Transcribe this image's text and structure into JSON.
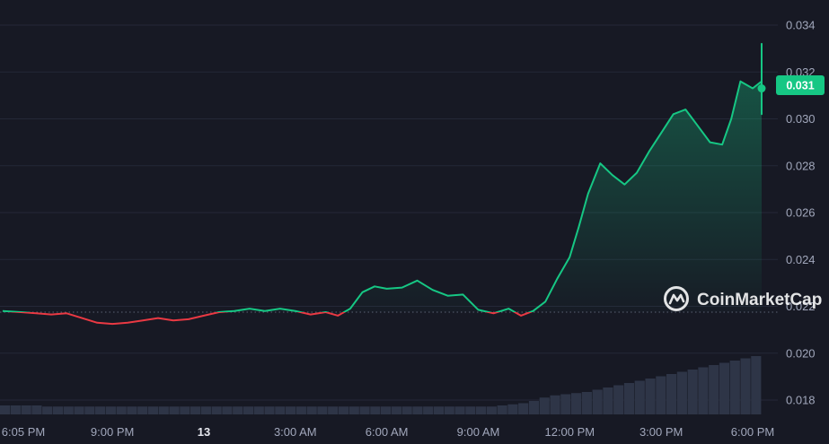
{
  "chart_data": {
    "type": "line",
    "reference_value": 0.02175,
    "current_price": 0.031,
    "current_price_label": "0.031",
    "ylim": [
      0.0175,
      0.0345
    ],
    "y_ticks": [
      {
        "value": 0.018,
        "label": "0.018"
      },
      {
        "value": 0.02,
        "label": "0.020"
      },
      {
        "value": 0.022,
        "label": "0.022"
      },
      {
        "value": 0.024,
        "label": "0.024"
      },
      {
        "value": 0.026,
        "label": "0.026"
      },
      {
        "value": 0.028,
        "label": "0.028"
      },
      {
        "value": 0.03,
        "label": "0.030"
      },
      {
        "value": 0.032,
        "label": "0.032"
      },
      {
        "value": 0.034,
        "label": "0.034"
      }
    ],
    "x_range": [
      -0.6,
      24.1
    ],
    "x_ticks": [
      {
        "value": 0.08,
        "label": "6:05 PM",
        "bold": false
      },
      {
        "value": 3,
        "label": "9:00 PM",
        "bold": false
      },
      {
        "value": 6,
        "label": "13",
        "bold": true
      },
      {
        "value": 9,
        "label": "3:00 AM",
        "bold": false
      },
      {
        "value": 12,
        "label": "6:00 AM",
        "bold": false
      },
      {
        "value": 15,
        "label": "9:00 AM",
        "bold": false
      },
      {
        "value": 18,
        "label": "12:00 PM",
        "bold": false
      },
      {
        "value": 21,
        "label": "3:00 PM",
        "bold": false
      },
      {
        "value": 24,
        "label": "6:00 PM",
        "bold": false
      }
    ],
    "x_unit": "hours since 6:00 PM (day 12)",
    "series": [
      {
        "points": [
          [
            -0.6,
            0.0218
          ],
          [
            0,
            0.02175
          ],
          [
            0.5,
            0.0217
          ],
          [
            1.0,
            0.02165
          ],
          [
            1.5,
            0.0217
          ],
          [
            2.0,
            0.0215
          ],
          [
            2.5,
            0.0213
          ],
          [
            3.0,
            0.02125
          ],
          [
            3.5,
            0.0213
          ],
          [
            4.0,
            0.0214
          ],
          [
            4.5,
            0.0215
          ],
          [
            5.0,
            0.0214
          ],
          [
            5.5,
            0.02145
          ],
          [
            6.0,
            0.0216
          ],
          [
            6.5,
            0.02175
          ],
          [
            7.0,
            0.0218
          ],
          [
            7.5,
            0.0219
          ],
          [
            8.0,
            0.0218
          ],
          [
            8.5,
            0.0219
          ],
          [
            9.0,
            0.0218
          ],
          [
            9.5,
            0.02165
          ],
          [
            10.0,
            0.02175
          ],
          [
            10.4,
            0.0216
          ],
          [
            10.8,
            0.0219
          ],
          [
            11.2,
            0.0226
          ],
          [
            11.6,
            0.02285
          ],
          [
            12.0,
            0.02275
          ],
          [
            12.5,
            0.0228
          ],
          [
            13.0,
            0.0231
          ],
          [
            13.5,
            0.0227
          ],
          [
            14.0,
            0.02245
          ],
          [
            14.5,
            0.0225
          ],
          [
            15.0,
            0.02185
          ],
          [
            15.5,
            0.0217
          ],
          [
            16.0,
            0.0219
          ],
          [
            16.4,
            0.0216
          ],
          [
            16.8,
            0.0218
          ],
          [
            17.2,
            0.0222
          ],
          [
            17.6,
            0.0232
          ],
          [
            18.0,
            0.0241
          ],
          [
            18.3,
            0.0254
          ],
          [
            18.6,
            0.0268
          ],
          [
            19.0,
            0.0281
          ],
          [
            19.4,
            0.0276
          ],
          [
            19.8,
            0.0272
          ],
          [
            20.2,
            0.0277
          ],
          [
            20.6,
            0.0286
          ],
          [
            21.0,
            0.0294
          ],
          [
            21.4,
            0.0302
          ],
          [
            21.8,
            0.0304
          ],
          [
            22.2,
            0.0297
          ],
          [
            22.6,
            0.029
          ],
          [
            23.0,
            0.0289
          ],
          [
            23.3,
            0.03
          ],
          [
            23.6,
            0.0316
          ],
          [
            24.0,
            0.0313
          ],
          [
            24.3,
            0.0316
          ],
          [
            24.6,
            0.0327
          ],
          [
            25.0,
            0.0325
          ],
          [
            25.3,
            0.0332
          ],
          [
            25.6,
            0.0306
          ],
          [
            25.8,
            0.0302
          ],
          [
            26.0,
            0.0311
          ],
          [
            26.2,
            0.0313
          ]
        ]
      }
    ],
    "volume_bars": [
      0.04,
      0.04,
      0.04,
      0.04,
      0.035,
      0.035,
      0.035,
      0.035,
      0.035,
      0.035,
      0.035,
      0.035,
      0.035,
      0.035,
      0.035,
      0.035,
      0.035,
      0.035,
      0.035,
      0.035,
      0.035,
      0.035,
      0.035,
      0.035,
      0.035,
      0.035,
      0.035,
      0.035,
      0.035,
      0.035,
      0.035,
      0.035,
      0.035,
      0.035,
      0.035,
      0.035,
      0.035,
      0.035,
      0.035,
      0.035,
      0.035,
      0.035,
      0.035,
      0.035,
      0.035,
      0.035,
      0.035,
      0.04,
      0.045,
      0.05,
      0.06,
      0.075,
      0.085,
      0.09,
      0.095,
      0.1,
      0.11,
      0.12,
      0.13,
      0.14,
      0.15,
      0.16,
      0.17,
      0.18,
      0.19,
      0.2,
      0.21,
      0.22,
      0.23,
      0.24,
      0.25,
      0.26
    ],
    "colors": {
      "up": "#16c784",
      "down": "#ea3943",
      "badge": "#16c784"
    }
  },
  "watermark": {
    "text": "CoinMarketCap",
    "icon": "coinmarketcap-logo-icon"
  }
}
